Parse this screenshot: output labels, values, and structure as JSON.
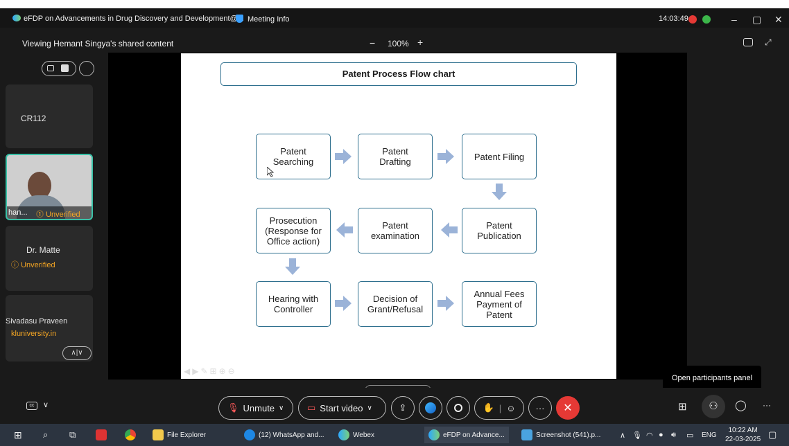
{
  "titlebar": {
    "meeting_title": "eFDP on Advancements in Drug Discovery and Development@...",
    "meeting_info": "Meeting Info",
    "clock": "14:03:49"
  },
  "viewbar": {
    "viewing_label": "Viewing Hemant Singya's shared content",
    "zoom": "100%",
    "zoom_minus": "−",
    "zoom_plus": "+"
  },
  "participants": [
    {
      "name": "CR112",
      "status": ""
    },
    {
      "name": "han...",
      "status": "Unverified"
    },
    {
      "name": "Dr. Matte",
      "status": "Unverified"
    },
    {
      "name": "Sivadasu Praveen",
      "status": "kluniversity.in"
    }
  ],
  "slide": {
    "title": "Patent Process Flow chart",
    "nodes": [
      "Patent\nSearching",
      "Patent\nDrafting",
      "Patent Filing",
      "Prosecution\n(Response for\nOffice action)",
      "Patent\nexamination",
      "Patent\nPublication",
      "Hearing with\nController",
      "Decision of\nGrant/Refusal",
      "Annual Fees\nPayment of\nPatent"
    ]
  },
  "controls": {
    "unmute": "Unmute",
    "start_video": "Start video",
    "tooltip": "Open participants panel"
  },
  "taskbar": {
    "file_explorer": "File Explorer",
    "whatsapp": "(12) WhatsApp and...",
    "webex": "Webex",
    "efdp": "eFDP on Advance...",
    "screenshot": "Screenshot (541).p...",
    "lang": "ENG",
    "time": "10:22 AM",
    "date": "22-03-2025"
  },
  "colors": {
    "accent": "#2e6f8e",
    "arrow": "#9bb3d8",
    "unverified": "#f5a623",
    "end_call": "#e53935"
  }
}
